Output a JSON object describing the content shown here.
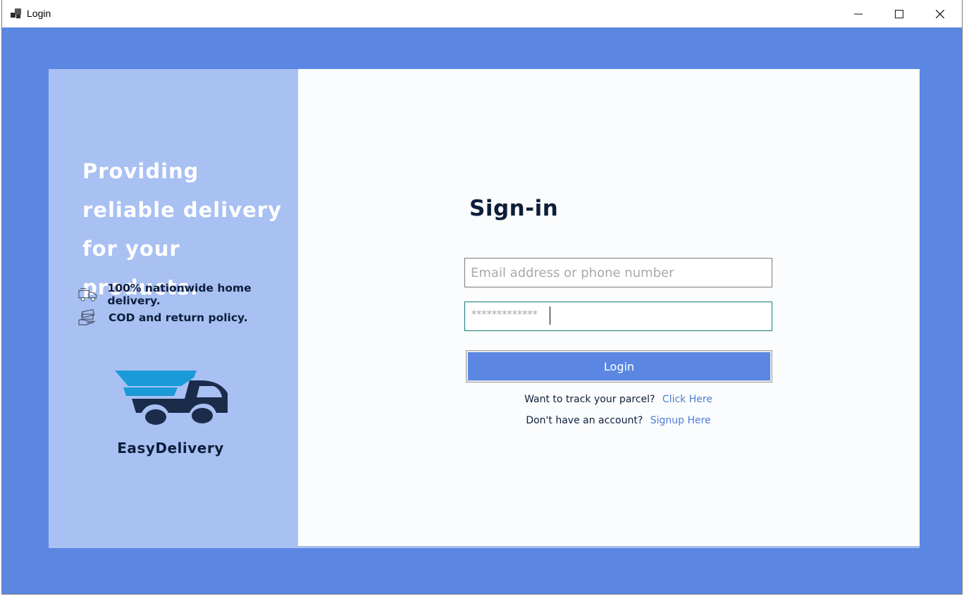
{
  "window": {
    "title": "Login",
    "controls": {
      "minimize": "minimize",
      "maximize": "maximize",
      "close": "close"
    }
  },
  "left_panel": {
    "headline": "Providing reliable delivery for your products.",
    "features": [
      {
        "icon": "delivery-truck-icon",
        "text": "100% nationwide home delivery."
      },
      {
        "icon": "cash-hand-icon",
        "text": "COD and return policy."
      }
    ],
    "brand": "EasyDelivery"
  },
  "form": {
    "title": "Sign-in",
    "email_placeholder": "Email address or phone number",
    "email_value": "",
    "password_value": "*************",
    "login_label": "Login",
    "track_prompt": "Want to track your parcel?",
    "track_link": "Click Here",
    "signup_prompt": "Don't have an account?",
    "signup_link": "Signup Here"
  },
  "colors": {
    "window_bg": "#5b87e3",
    "left_panel": "#a8c0f2",
    "dark_text": "#0d1e3a",
    "link": "#4a7ed8",
    "logo_light": "#1a9ad6",
    "logo_dark": "#1b2b4a"
  }
}
